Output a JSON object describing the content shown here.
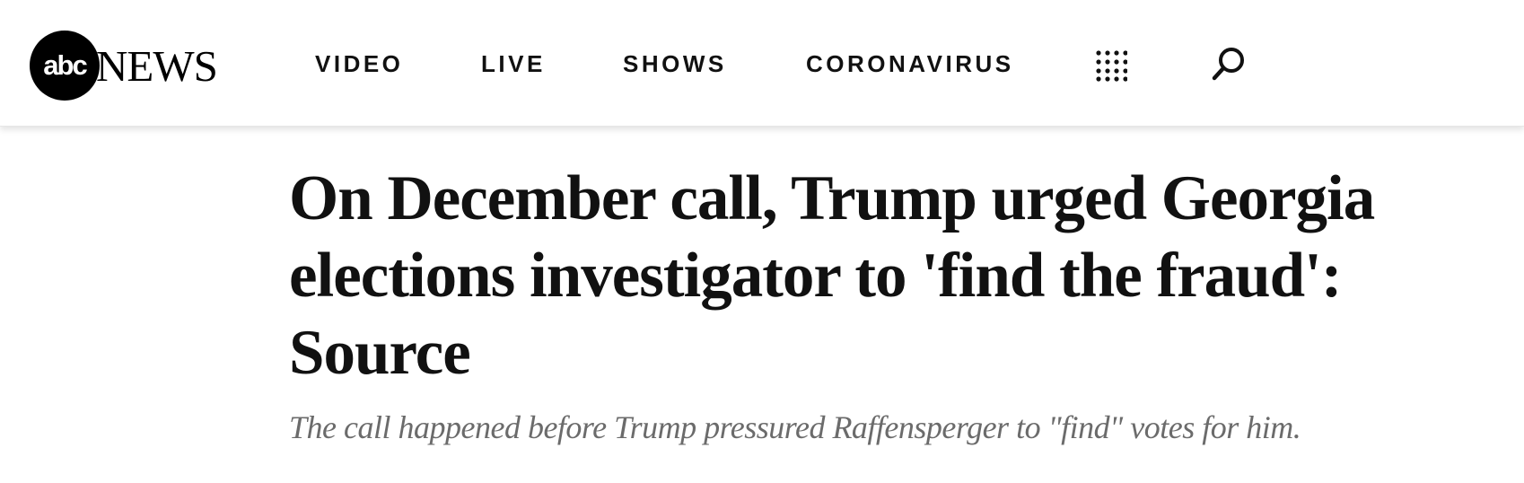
{
  "header": {
    "logo": {
      "mark_text": "abc",
      "wordmark": "NEWS"
    },
    "nav": [
      {
        "label": "VIDEO"
      },
      {
        "label": "LIVE"
      },
      {
        "label": "SHOWS"
      },
      {
        "label": "CORONAVIRUS"
      }
    ],
    "icons": {
      "menu": "grid-dots-icon",
      "search": "search-icon"
    }
  },
  "article": {
    "headline": "On December call, Trump urged Georgia elections investigator to 'find the fraud': Source",
    "subheadline": "The call happened before Trump pressured Raffensperger to \"find\" votes for him."
  },
  "colors": {
    "text": "#111111",
    "subhead": "#6b6b6b",
    "logo_bg": "#000000"
  }
}
